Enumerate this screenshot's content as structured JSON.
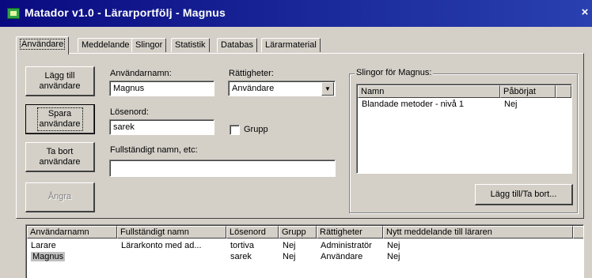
{
  "window": {
    "title": "Matador v1.0 - Lärarportfölj - Magnus",
    "close_glyph": "×"
  },
  "tabs": [
    {
      "label": "Användare"
    },
    {
      "label": "Meddelande"
    },
    {
      "label": "Slingor"
    },
    {
      "label": "Statistik"
    },
    {
      "label": "Databas"
    },
    {
      "label": "Lärarmaterial"
    }
  ],
  "buttons": {
    "add_user": {
      "line1": "Lägg till",
      "line2": "användare"
    },
    "save_user": {
      "line1": "Spara",
      "line2": "användare"
    },
    "delete_user": {
      "line1": "Ta bort",
      "line2": "användare"
    },
    "cancel": "Ångra",
    "add_remove_loops": "Lägg till/Ta bort..."
  },
  "form": {
    "username_label": "Användarnamn:",
    "username_value": "Magnus",
    "rights_label": "Rättigheter:",
    "rights_value": "Användare",
    "password_label": "Lösenord:",
    "password_value": "sarek",
    "group_label": "Grupp",
    "fullname_label": "Fullständigt namn, etc:",
    "fullname_value": ""
  },
  "loops_group": {
    "title": "Slingor för Magnus:",
    "columns": [
      "Namn",
      "Påbörjat"
    ],
    "rows": [
      {
        "name": "Blandade metoder - nivå 1",
        "started": "Nej"
      }
    ]
  },
  "users_table": {
    "columns": [
      "Användarnamn",
      "Fullständigt namn",
      "Lösenord",
      "Grupp",
      "Rättigheter",
      "Nytt meddelande till läraren"
    ],
    "rows": [
      {
        "username": "Larare",
        "fullname": "Lärarkonto med ad...",
        "password": "tortiva",
        "group": "Nej",
        "rights": "Administratör",
        "new_msg": "Nej"
      },
      {
        "username": "Magnus",
        "fullname": "",
        "password": "sarek",
        "group": "Nej",
        "rights": "Användare",
        "new_msg": "Nej"
      }
    ]
  },
  "icons": {
    "app": "matador-app-icon",
    "close": "close-icon",
    "dropdown": "chevron-down-icon"
  }
}
